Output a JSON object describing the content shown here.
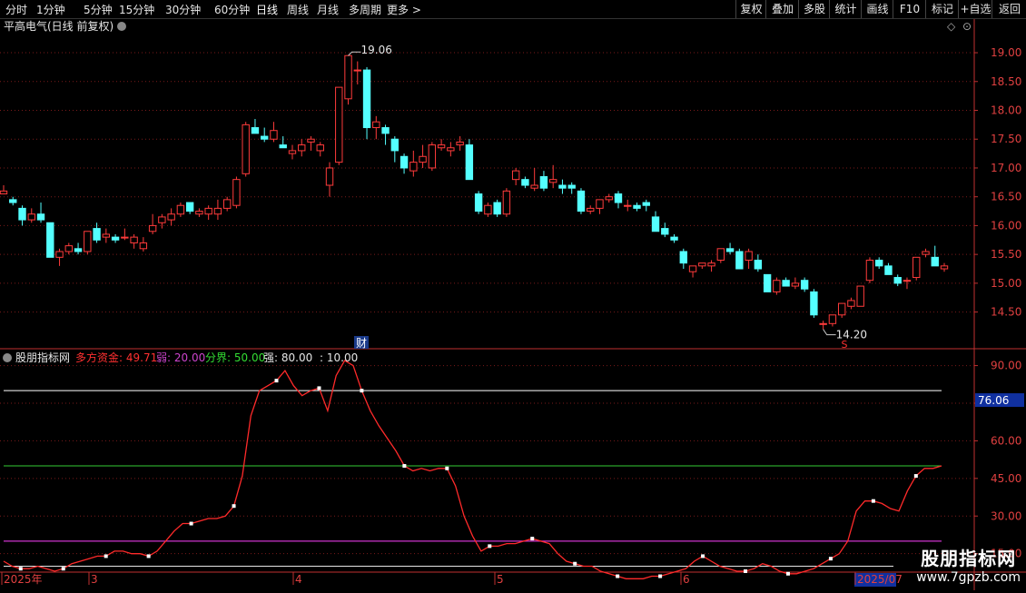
{
  "toolbar": {
    "periods": [
      "分时",
      "1分钟",
      "5分钟",
      "15分钟",
      "30分钟",
      "60分钟",
      "日线",
      "周线",
      "月线",
      "多周期",
      "更多 >"
    ],
    "active_period": "日线",
    "actions": [
      "复权",
      "叠加",
      "多股",
      "统计",
      "画线",
      "F10",
      "标记",
      "+自选",
      "返回"
    ]
  },
  "main_panel": {
    "title": "平高电气(日线 前复权)",
    "high_label": "19.06",
    "low_label": "14.20",
    "finance_marker": "财",
    "s_marker": "S",
    "price_axis": [
      "19.00",
      "18.50",
      "18.00",
      "17.50",
      "17.00",
      "16.50",
      "16.00",
      "15.50",
      "15.00",
      "14.50"
    ]
  },
  "indicator_panel": {
    "name": "股朋指标网",
    "line_label": "多方资金: 49.71",
    "weak_label": "弱: 20.00",
    "divide_label": "分界: 50.00",
    "strong_label": "强: 80.00",
    "extra_label": ": 10.00",
    "axis": [
      "90.00",
      "75.00",
      "60.00",
      "45.00",
      "30.00",
      "15.00"
    ],
    "current_value": "76.06"
  },
  "date_axis": [
    "2025年",
    "3",
    "4",
    "5",
    "6",
    "2025/07"
  ],
  "watermark": {
    "title": "股朋指标网",
    "url": "www.7gpzb.com"
  },
  "colors": {
    "up": "#ff3b3b",
    "down": "#54ffff",
    "line": "#ff2a2a",
    "weak": "#cc33cc",
    "divide": "#33cc33",
    "strong": "#ffffff"
  },
  "chart_data": {
    "type": "candlestick",
    "price_ylim": [
      14.1,
      19.3
    ],
    "candles": [
      [
        16.55,
        16.7,
        16.55,
        16.6
      ],
      [
        16.45,
        16.5,
        16.35,
        16.4
      ],
      [
        16.3,
        16.35,
        16.0,
        16.1
      ],
      [
        16.1,
        16.3,
        16.05,
        16.2
      ],
      [
        16.2,
        16.4,
        16.05,
        16.1
      ],
      [
        16.05,
        16.05,
        15.45,
        15.45
      ],
      [
        15.45,
        15.6,
        15.3,
        15.55
      ],
      [
        15.55,
        15.7,
        15.5,
        15.65
      ],
      [
        15.6,
        15.7,
        15.5,
        15.55
      ],
      [
        15.55,
        15.9,
        15.5,
        15.9
      ],
      [
        15.95,
        16.05,
        15.7,
        15.75
      ],
      [
        15.8,
        15.95,
        15.7,
        15.85
      ],
      [
        15.8,
        15.85,
        15.7,
        15.75
      ],
      [
        15.8,
        15.95,
        15.75,
        15.8
      ],
      [
        15.7,
        15.85,
        15.6,
        15.8
      ],
      [
        15.6,
        15.8,
        15.55,
        15.7
      ],
      [
        15.9,
        16.2,
        15.85,
        16.0
      ],
      [
        16.05,
        16.2,
        15.95,
        16.15
      ],
      [
        16.1,
        16.3,
        16.0,
        16.2
      ],
      [
        16.2,
        16.4,
        16.15,
        16.35
      ],
      [
        16.4,
        16.4,
        16.2,
        16.25
      ],
      [
        16.2,
        16.3,
        16.15,
        16.25
      ],
      [
        16.2,
        16.35,
        16.1,
        16.3
      ],
      [
        16.2,
        16.45,
        16.1,
        16.3
      ],
      [
        16.3,
        16.5,
        16.25,
        16.45
      ],
      [
        16.35,
        16.85,
        16.3,
        16.8
      ],
      [
        16.9,
        17.8,
        16.85,
        17.75
      ],
      [
        17.7,
        17.85,
        17.6,
        17.6
      ],
      [
        17.55,
        17.7,
        17.45,
        17.5
      ],
      [
        17.5,
        17.8,
        17.45,
        17.65
      ],
      [
        17.4,
        17.55,
        17.35,
        17.35
      ],
      [
        17.25,
        17.4,
        17.15,
        17.3
      ],
      [
        17.3,
        17.5,
        17.2,
        17.4
      ],
      [
        17.45,
        17.55,
        17.3,
        17.5
      ],
      [
        17.3,
        17.45,
        17.2,
        17.4
      ],
      [
        16.7,
        17.1,
        16.5,
        17.0
      ],
      [
        17.1,
        18.4,
        17.05,
        18.4
      ],
      [
        18.2,
        18.95,
        18.1,
        18.95
      ],
      [
        18.7,
        18.85,
        18.45,
        18.7
      ],
      [
        18.7,
        18.75,
        17.5,
        17.7
      ],
      [
        17.7,
        17.9,
        17.5,
        17.8
      ],
      [
        17.7,
        17.75,
        17.4,
        17.6
      ],
      [
        17.5,
        17.55,
        17.1,
        17.3
      ],
      [
        17.2,
        17.25,
        16.9,
        17.0
      ],
      [
        16.95,
        17.3,
        16.85,
        17.1
      ],
      [
        17.1,
        17.4,
        17.0,
        17.2
      ],
      [
        17.0,
        17.45,
        16.95,
        17.4
      ],
      [
        17.35,
        17.5,
        17.3,
        17.4
      ],
      [
        17.3,
        17.45,
        17.2,
        17.35
      ],
      [
        17.4,
        17.55,
        17.3,
        17.45
      ],
      [
        17.4,
        17.5,
        16.8,
        16.8
      ],
      [
        16.55,
        16.6,
        16.2,
        16.25
      ],
      [
        16.2,
        16.4,
        16.15,
        16.35
      ],
      [
        16.4,
        16.45,
        16.15,
        16.2
      ],
      [
        16.2,
        16.65,
        16.15,
        16.6
      ],
      [
        16.8,
        17.0,
        16.7,
        16.95
      ],
      [
        16.8,
        16.85,
        16.65,
        16.7
      ],
      [
        16.65,
        17.0,
        16.6,
        16.7
      ],
      [
        16.85,
        16.95,
        16.6,
        16.65
      ],
      [
        16.75,
        17.05,
        16.65,
        16.8
      ],
      [
        16.7,
        16.8,
        16.55,
        16.65
      ],
      [
        16.7,
        16.75,
        16.55,
        16.65
      ],
      [
        16.6,
        16.65,
        16.2,
        16.25
      ],
      [
        16.25,
        16.35,
        16.2,
        16.3
      ],
      [
        16.3,
        16.45,
        16.2,
        16.45
      ],
      [
        16.45,
        16.55,
        16.4,
        16.5
      ],
      [
        16.55,
        16.6,
        16.3,
        16.4
      ],
      [
        16.35,
        16.45,
        16.25,
        16.35
      ],
      [
        16.35,
        16.4,
        16.25,
        16.3
      ],
      [
        16.4,
        16.45,
        16.25,
        16.35
      ],
      [
        16.15,
        16.25,
        15.9,
        15.9
      ],
      [
        15.95,
        16.05,
        15.8,
        15.85
      ],
      [
        15.8,
        15.85,
        15.7,
        15.75
      ],
      [
        15.55,
        15.6,
        15.25,
        15.35
      ],
      [
        15.2,
        15.3,
        15.1,
        15.3
      ],
      [
        15.3,
        15.35,
        15.25,
        15.35
      ],
      [
        15.3,
        15.4,
        15.2,
        15.35
      ],
      [
        15.4,
        15.6,
        15.35,
        15.6
      ],
      [
        15.6,
        15.7,
        15.5,
        15.55
      ],
      [
        15.55,
        15.6,
        15.25,
        15.25
      ],
      [
        15.4,
        15.6,
        15.25,
        15.55
      ],
      [
        15.4,
        15.5,
        15.2,
        15.25
      ],
      [
        15.15,
        15.15,
        14.85,
        14.85
      ],
      [
        14.85,
        15.1,
        14.8,
        15.05
      ],
      [
        15.05,
        15.1,
        14.95,
        14.95
      ],
      [
        14.95,
        15.1,
        14.9,
        15.0
      ],
      [
        15.05,
        15.1,
        14.85,
        14.9
      ],
      [
        14.85,
        14.9,
        14.4,
        14.45
      ],
      [
        14.3,
        14.35,
        14.2,
        14.3
      ],
      [
        14.3,
        14.45,
        14.25,
        14.45
      ],
      [
        14.45,
        14.65,
        14.4,
        14.65
      ],
      [
        14.6,
        14.75,
        14.55,
        14.7
      ],
      [
        14.6,
        14.95,
        14.6,
        14.95
      ],
      [
        15.05,
        15.45,
        15.0,
        15.4
      ],
      [
        15.4,
        15.45,
        15.25,
        15.3
      ],
      [
        15.3,
        15.35,
        15.15,
        15.15
      ],
      [
        15.1,
        15.15,
        14.95,
        15.0
      ],
      [
        15.05,
        15.1,
        14.9,
        15.05
      ],
      [
        15.1,
        15.45,
        15.05,
        15.45
      ],
      [
        15.5,
        15.6,
        15.45,
        15.55
      ],
      [
        15.45,
        15.65,
        15.3,
        15.3
      ],
      [
        15.25,
        15.35,
        15.2,
        15.3
      ]
    ],
    "indicator_ylim": [
      8,
      96
    ],
    "indicator_line": [
      12,
      10,
      9,
      9,
      10,
      9,
      8,
      9,
      11,
      12,
      13,
      14,
      14,
      16,
      16,
      15,
      15,
      14,
      16,
      20,
      24,
      27,
      27,
      28,
      29,
      29,
      30,
      34,
      46,
      70,
      80,
      82,
      84,
      88,
      82,
      78,
      80,
      81,
      72,
      86,
      92,
      90,
      80,
      72,
      66,
      61,
      56,
      50,
      48,
      49,
      48,
      49,
      49,
      42,
      30,
      22,
      16,
      18,
      18,
      19,
      19,
      20,
      21,
      20,
      19,
      15,
      12,
      11,
      10,
      10,
      8,
      7,
      6,
      5,
      5,
      5,
      6,
      6,
      7,
      8,
      9,
      12,
      14,
      12,
      10,
      9,
      8,
      8,
      9,
      11,
      10,
      8,
      7,
      7,
      8,
      9,
      11,
      13,
      15,
      20,
      32,
      36,
      36,
      35,
      33,
      32,
      40,
      46,
      49,
      49,
      50
    ],
    "series": [
      {
        "name": "多方资金",
        "values": "indicator_line"
      }
    ],
    "reference_lines": {
      "weak": 20,
      "divide": 50,
      "strong": 80,
      "extra": 10
    }
  }
}
